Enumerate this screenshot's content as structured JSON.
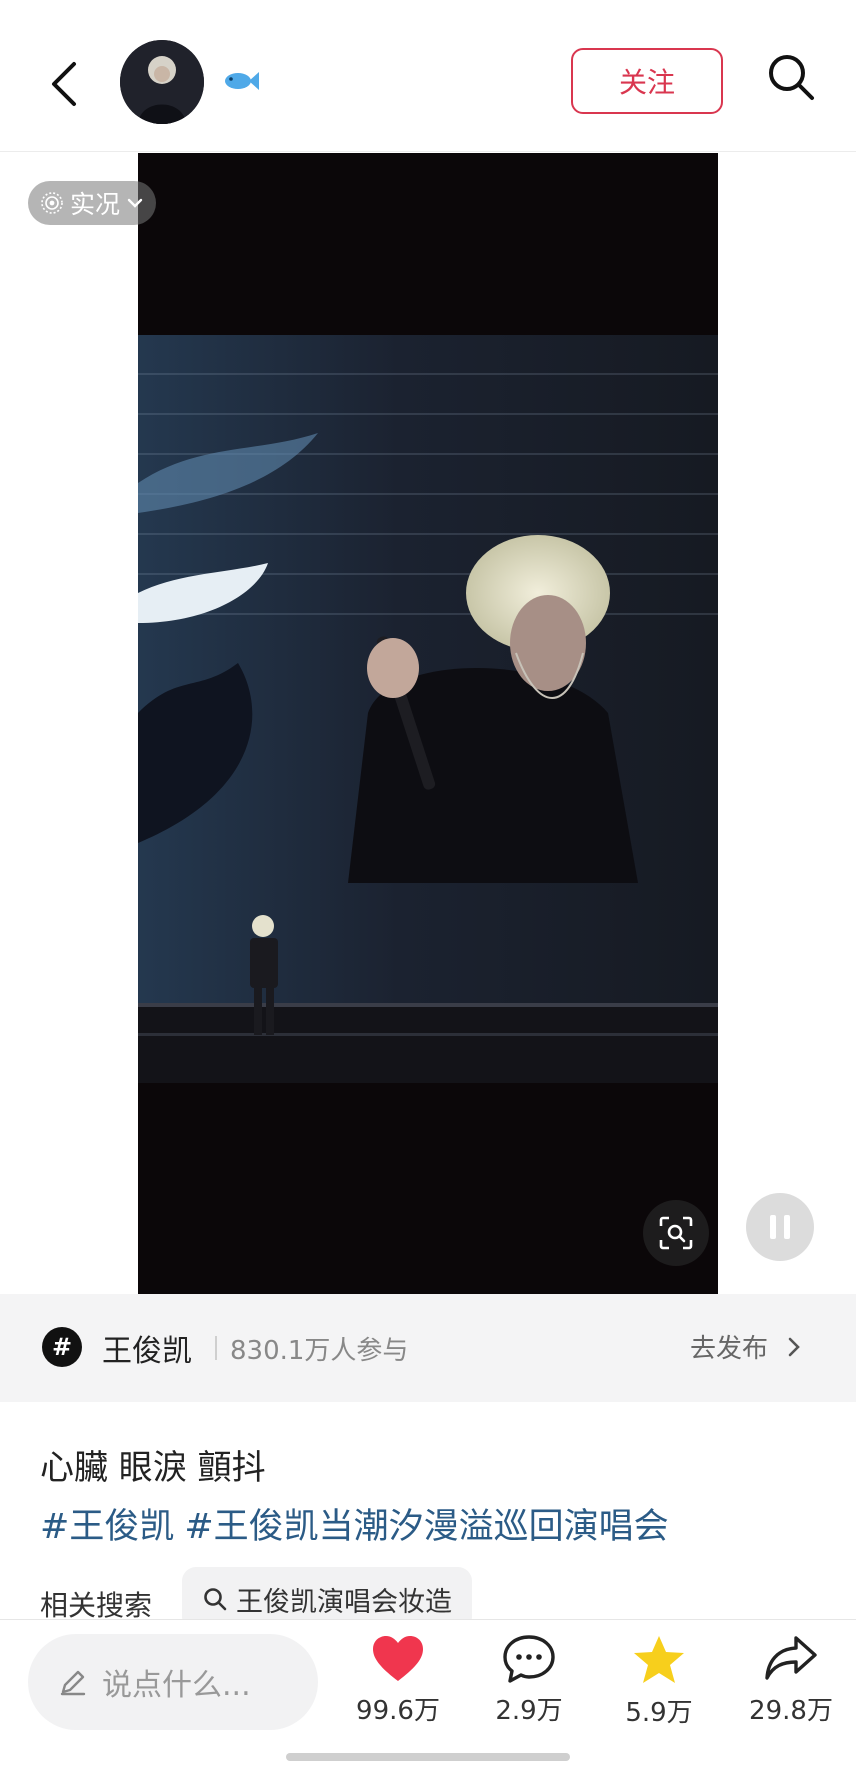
{
  "header": {
    "follow_label": "关注"
  },
  "media": {
    "live_label": "实况"
  },
  "topic": {
    "name": "王俊凯",
    "participants": "830.1万人参与",
    "publish_label": "去发布"
  },
  "post": {
    "caption": "心臟 眼淚 顫抖",
    "hashtags": [
      "#王俊凯",
      "#王俊凯当潮汐漫溢巡回演唱会"
    ]
  },
  "related": {
    "label": "相关搜索",
    "query": "王俊凯演唱会妆造"
  },
  "bottom_bar": {
    "comment_placeholder": "说点什么...",
    "likes": "99.6万",
    "comments": "2.9万",
    "favorites": "5.9万",
    "shares": "29.8万"
  },
  "colors": {
    "accent": "#d9364f",
    "hashtag": "#2b5b86",
    "like": "#f0364e",
    "favorite": "#f7cf1c"
  }
}
